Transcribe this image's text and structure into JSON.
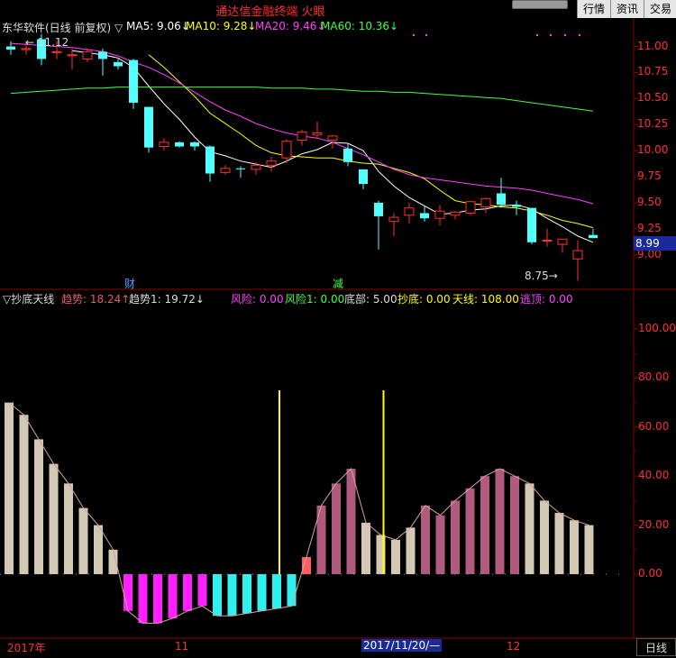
{
  "window": {
    "title": "通达信金融终端 火眼",
    "buttons": [
      "行情",
      "资讯",
      "交易"
    ]
  },
  "price_panel": {
    "legend": {
      "stock": "东华软件(日线 前复权) ▽",
      "ma5": "MA5: 9.06↓",
      "ma10": "MA10: 9.28↓",
      "ma20": "MA20: 9.46↓",
      "ma60": "MA60: 10.36↓"
    },
    "axis_ticks": [
      "11.00",
      "10.75",
      "10.50",
      "10.25",
      "10.00",
      "9.75",
      "9.50",
      "9.25",
      "9.00"
    ],
    "current_price": "8.99",
    "high_label": "11.12",
    "low_label": "8.75",
    "event_marks": [
      "财",
      "减"
    ]
  },
  "indicator_panel": {
    "legend": {
      "name": "▽抄底天线",
      "trend": "趋势: 18.24↑",
      "trend1": "趋势1: 19.72↓",
      "risk": "风险: 0.00",
      "risk1": "风险1: 0.00",
      "bottom": "底部: 5.00",
      "chaodi": "抄底: 0.00",
      "tianxian": "天线: 108.00",
      "taoding": "逃顶: 0.00"
    },
    "axis_ticks": [
      "100.00",
      "80.00",
      "60.00",
      "40.00",
      "20.00",
      "0.00"
    ]
  },
  "time_axis": {
    "labels": [
      "2017年",
      "11",
      "2017/11/20/—",
      "12"
    ],
    "period_button": "日线"
  },
  "colors": {
    "up_candle": "#ff3030",
    "down_candle": "#54ffff",
    "ma5": "#ffffff",
    "ma10": "#ffff00",
    "ma20": "#ff40ff",
    "ma60": "#40ff40",
    "grid": "#8b0000"
  },
  "chart_data": [
    {
      "type": "candlestick",
      "title": "东华软件(日线 前复权)",
      "ylim": [
        8.7,
        11.2
      ],
      "candles": [
        {
          "o": 11.0,
          "h": 11.05,
          "l": 10.92,
          "c": 10.97
        },
        {
          "o": 10.97,
          "h": 11.05,
          "l": 10.92,
          "c": 10.98
        },
        {
          "o": 11.07,
          "h": 11.12,
          "l": 10.82,
          "c": 10.88
        },
        {
          "o": 10.95,
          "h": 11.05,
          "l": 10.88,
          "c": 10.95
        },
        {
          "o": 10.92,
          "h": 10.98,
          "l": 10.78,
          "c": 10.92
        },
        {
          "o": 10.88,
          "h": 10.98,
          "l": 10.85,
          "c": 10.95
        },
        {
          "o": 10.95,
          "h": 10.98,
          "l": 10.72,
          "c": 10.88
        },
        {
          "o": 10.85,
          "h": 10.88,
          "l": 10.78,
          "c": 10.81
        },
        {
          "o": 10.87,
          "h": 10.88,
          "l": 10.4,
          "c": 10.46
        },
        {
          "o": 10.42,
          "h": 10.42,
          "l": 9.98,
          "c": 10.03
        },
        {
          "o": 10.04,
          "h": 10.12,
          "l": 10.0,
          "c": 10.08
        },
        {
          "o": 10.08,
          "h": 10.09,
          "l": 10.03,
          "c": 10.04
        },
        {
          "o": 10.08,
          "h": 10.09,
          "l": 10.0,
          "c": 10.04
        },
        {
          "o": 10.04,
          "h": 10.05,
          "l": 9.7,
          "c": 9.78
        },
        {
          "o": 9.79,
          "h": 9.86,
          "l": 9.77,
          "c": 9.83
        },
        {
          "o": 9.83,
          "h": 9.85,
          "l": 9.74,
          "c": 9.82
        },
        {
          "o": 9.82,
          "h": 9.89,
          "l": 9.77,
          "c": 9.86
        },
        {
          "o": 9.86,
          "h": 9.94,
          "l": 9.8,
          "c": 9.9
        },
        {
          "o": 9.93,
          "h": 10.11,
          "l": 9.88,
          "c": 10.09
        },
        {
          "o": 10.1,
          "h": 10.2,
          "l": 10.05,
          "c": 10.18
        },
        {
          "o": 10.15,
          "h": 10.28,
          "l": 10.12,
          "c": 10.17
        },
        {
          "o": 10.1,
          "h": 10.15,
          "l": 10.02,
          "c": 10.14
        },
        {
          "o": 10.02,
          "h": 10.07,
          "l": 9.85,
          "c": 9.89
        },
        {
          "o": 9.82,
          "h": 9.82,
          "l": 9.63,
          "c": 9.68
        },
        {
          "o": 9.5,
          "h": 9.52,
          "l": 9.05,
          "c": 9.37
        },
        {
          "o": 9.32,
          "h": 9.4,
          "l": 9.18,
          "c": 9.36
        },
        {
          "o": 9.38,
          "h": 9.5,
          "l": 9.3,
          "c": 9.45
        },
        {
          "o": 9.4,
          "h": 9.47,
          "l": 9.32,
          "c": 9.35
        },
        {
          "o": 9.35,
          "h": 9.48,
          "l": 9.28,
          "c": 9.42
        },
        {
          "o": 9.38,
          "h": 9.42,
          "l": 9.34,
          "c": 9.41
        },
        {
          "o": 9.4,
          "h": 9.52,
          "l": 9.38,
          "c": 9.51
        },
        {
          "o": 9.46,
          "h": 9.55,
          "l": 9.4,
          "c": 9.54
        },
        {
          "o": 9.59,
          "h": 9.74,
          "l": 9.45,
          "c": 9.48
        },
        {
          "o": 9.48,
          "h": 9.52,
          "l": 9.38,
          "c": 9.46
        },
        {
          "o": 9.45,
          "h": 9.45,
          "l": 9.1,
          "c": 9.12
        },
        {
          "o": 9.14,
          "h": 9.25,
          "l": 9.08,
          "c": 9.14
        },
        {
          "o": 9.1,
          "h": 9.15,
          "l": 9.02,
          "c": 9.15
        },
        {
          "o": 8.96,
          "h": 9.14,
          "l": 8.75,
          "c": 9.04
        },
        {
          "o": 9.19,
          "h": 9.25,
          "l": 9.16,
          "c": 9.16
        }
      ],
      "series": [
        {
          "name": "MA5",
          "values": [
            null,
            null,
            null,
            null,
            10.96,
            10.94,
            10.92,
            10.89,
            10.8,
            10.62,
            10.45,
            10.3,
            10.13,
            9.99,
            9.95,
            9.9,
            9.87,
            9.84,
            9.9,
            9.97,
            10.01,
            10.08,
            10.07,
            10.0,
            9.8,
            9.66,
            9.55,
            9.47,
            9.39,
            9.4,
            9.43,
            9.44,
            9.47,
            9.48,
            9.44,
            9.35,
            9.27,
            9.18,
            9.12
          ]
        },
        {
          "name": "MA10",
          "values": [
            null,
            null,
            null,
            null,
            null,
            null,
            null,
            null,
            null,
            10.92,
            10.8,
            10.66,
            10.52,
            10.36,
            10.26,
            10.16,
            10.05,
            9.98,
            9.95,
            9.94,
            9.93,
            9.93,
            9.9,
            9.88,
            9.87,
            9.83,
            9.79,
            9.73,
            9.62,
            9.52,
            9.49,
            9.48,
            9.46,
            9.45,
            9.42,
            9.38,
            9.33,
            9.3,
            9.26
          ]
        },
        {
          "name": "MA20",
          "values": [
            11.03,
            11.02,
            11.01,
            11.0,
            10.99,
            10.97,
            10.95,
            10.91,
            10.85,
            10.8,
            10.73,
            10.65,
            10.56,
            10.47,
            10.39,
            10.33,
            10.26,
            10.21,
            10.17,
            10.14,
            10.12,
            10.08,
            10.02,
            9.96,
            9.89,
            9.82,
            9.77,
            9.74,
            9.72,
            9.7,
            9.68,
            9.66,
            9.65,
            9.64,
            9.62,
            9.59,
            9.56,
            9.53,
            9.49
          ]
        },
        {
          "name": "MA60",
          "values": [
            10.55,
            10.56,
            10.57,
            10.58,
            10.59,
            10.6,
            10.6,
            10.61,
            10.61,
            10.61,
            10.61,
            10.61,
            10.61,
            10.61,
            10.61,
            10.61,
            10.61,
            10.6,
            10.6,
            10.6,
            10.59,
            10.59,
            10.58,
            10.57,
            10.57,
            10.56,
            10.56,
            10.55,
            10.54,
            10.53,
            10.52,
            10.51,
            10.5,
            10.48,
            10.46,
            10.44,
            10.42,
            10.4,
            10.38
          ]
        }
      ]
    },
    {
      "type": "bar",
      "title": "抄底天线",
      "ylim": [
        -20,
        120
      ],
      "bars": [
        {
          "v": 70,
          "c": "#d2c8b4"
        },
        {
          "v": 65,
          "c": "#d2c8b4"
        },
        {
          "v": 55,
          "c": "#d2c8b4"
        },
        {
          "v": 45,
          "c": "#d2c8b4"
        },
        {
          "v": 37,
          "c": "#d2c8b4"
        },
        {
          "v": 27,
          "c": "#d2c8b4"
        },
        {
          "v": 20,
          "c": "#d2c8b4"
        },
        {
          "v": 10,
          "c": "#d2c8b4"
        },
        {
          "v": -15,
          "c": "#ff20ff"
        },
        {
          "v": -20,
          "c": "#ff20ff"
        },
        {
          "v": -20,
          "c": "#ff20ff"
        },
        {
          "v": -18,
          "c": "#ff20ff"
        },
        {
          "v": -15,
          "c": "#ff20ff"
        },
        {
          "v": -13,
          "c": "#ff20ff"
        },
        {
          "v": -17,
          "c": "#30f0f0"
        },
        {
          "v": -17,
          "c": "#30f0f0"
        },
        {
          "v": -16,
          "c": "#30f0f0"
        },
        {
          "v": -15,
          "c": "#30f0f0"
        },
        {
          "v": -14,
          "c": "#30f0f0"
        },
        {
          "v": -13,
          "c": "#30f0f0"
        },
        {
          "v": 7,
          "c": "#ff6060"
        },
        {
          "v": 28,
          "c": "#b05a80"
        },
        {
          "v": 37,
          "c": "#b05a80"
        },
        {
          "v": 43,
          "c": "#b05a80"
        },
        {
          "v": 21,
          "c": "#d2c8b4"
        },
        {
          "v": 16,
          "c": "#d2c8b4"
        },
        {
          "v": 14,
          "c": "#d2c8b4"
        },
        {
          "v": 19,
          "c": "#d2c8b4"
        },
        {
          "v": 28,
          "c": "#b05a80"
        },
        {
          "v": 24,
          "c": "#b05a80"
        },
        {
          "v": 30,
          "c": "#b05a80"
        },
        {
          "v": 35,
          "c": "#b05a80"
        },
        {
          "v": 40,
          "c": "#b05a80"
        },
        {
          "v": 43,
          "c": "#b05a80"
        },
        {
          "v": 40,
          "c": "#b05a80"
        },
        {
          "v": 37,
          "c": "#d2c8b4"
        },
        {
          "v": 30,
          "c": "#d2c8b4"
        },
        {
          "v": 25,
          "c": "#d2c8b4"
        },
        {
          "v": 22,
          "c": "#d2c8b4"
        },
        {
          "v": 20,
          "c": "#d2c8b4"
        }
      ],
      "signal_lines_at": [
        18,
        25
      ]
    }
  ]
}
